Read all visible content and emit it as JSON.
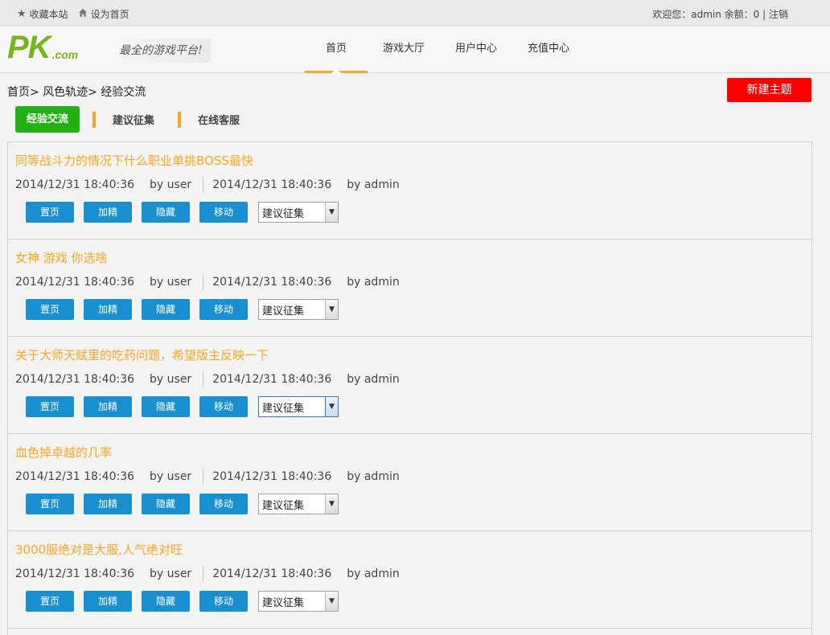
{
  "topbar": {
    "bookmark_icon": "star-icon",
    "bookmark_label": "收藏本站",
    "homepage_icon": "home-icon",
    "homepage_label": "设为首页",
    "welcome": "欢迎您：admin 余额：0 | 注销"
  },
  "header": {
    "logo_main": "PK",
    "logo_suffix": ".com",
    "slogan": "最全的游戏平台!",
    "nav": [
      "首页",
      "游戏大厅",
      "用户中心",
      "充值中心"
    ],
    "nav_active_index": 0
  },
  "breadcrumb": "首页> 风色轨迹> 经验交流",
  "new_topic_label": "新建主题",
  "tabs": {
    "active": "经验交流",
    "items": [
      "建议征集",
      "在线客服"
    ]
  },
  "action_labels": {
    "top": "置页",
    "digest": "加精",
    "hide": "隐藏",
    "move": "移动"
  },
  "posts": [
    {
      "title": "同等战斗力的情况下什么职业单挑BOSS最快",
      "created": "2014/12/31 18:40:36",
      "author": "by user",
      "replied": "2014/12/31 18:40:36",
      "replier": "by admin",
      "category": "建议征集"
    },
    {
      "title": "女神 游戏 你选啥",
      "created": "2014/12/31 18:40:36",
      "author": "by user",
      "replied": "2014/12/31 18:40:36",
      "replier": "by admin",
      "category": "建议征集"
    },
    {
      "title": "关于大师天赋里的吃药问题，希望版主反映一下",
      "created": "2014/12/31 18:40:36",
      "author": "by user",
      "replied": "2014/12/31 18:40:36",
      "replier": "by admin",
      "category": "建议征集"
    },
    {
      "title": "血色掉卓越的几率",
      "created": "2014/12/31 18:40:36",
      "author": "by user",
      "replied": "2014/12/31 18:40:36",
      "replier": "by admin",
      "category": "建议征集"
    },
    {
      "title": "3000服绝对是大服,人气绝对旺",
      "created": "2014/12/31 18:40:36",
      "author": "by user",
      "replied": "2014/12/31 18:40:36",
      "replier": "by admin",
      "category": "建议征集"
    }
  ],
  "colors": {
    "accent_orange": "#f5a623",
    "logo_green": "#75b41f",
    "tab_green": "#23b014",
    "action_blue": "#1a8fd0",
    "new_topic_red": "#ff0000"
  }
}
